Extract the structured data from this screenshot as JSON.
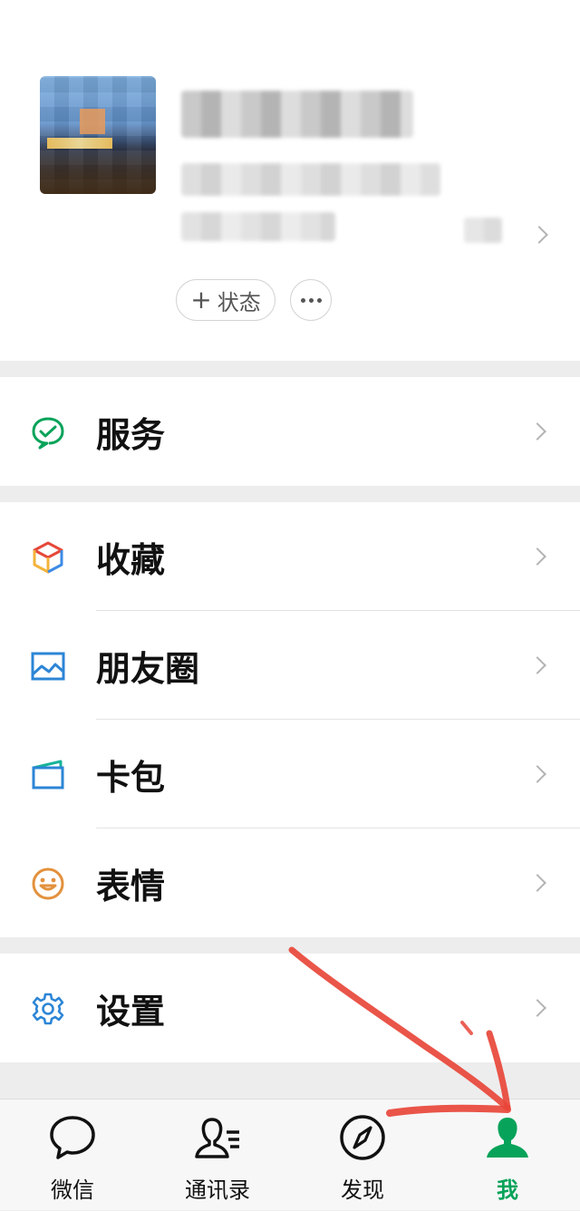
{
  "profile": {
    "status_label": "状态",
    "status_plus": "+"
  },
  "menu": {
    "service": "服务",
    "favorites": "收藏",
    "moments": "朋友圈",
    "cards": "卡包",
    "stickers": "表情",
    "settings": "设置"
  },
  "tabs": [
    {
      "label": "微信",
      "icon": "chat-bubble-icon",
      "active": false
    },
    {
      "label": "通讯录",
      "icon": "contacts-icon",
      "active": false
    },
    {
      "label": "发现",
      "icon": "compass-icon",
      "active": false
    },
    {
      "label": "我",
      "icon": "person-icon",
      "active": true
    }
  ],
  "colors": {
    "accent": "#07a35a",
    "annotation": "#e8473a",
    "background": "#ededed"
  }
}
